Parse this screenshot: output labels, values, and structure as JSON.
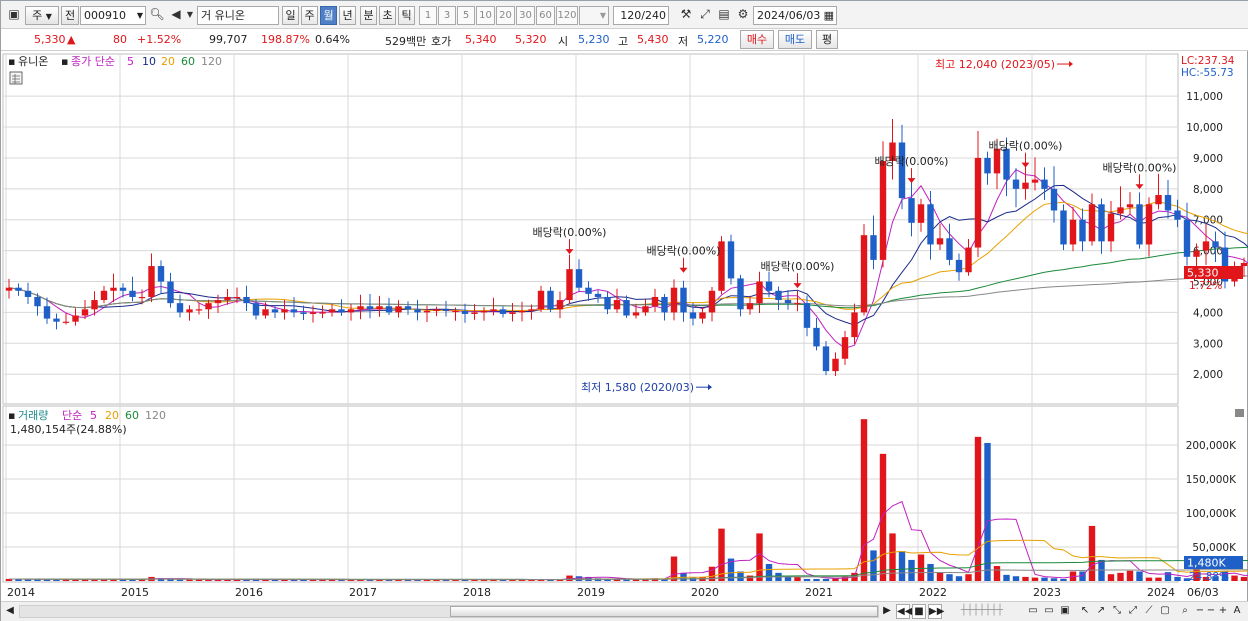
{
  "toolbar": {
    "market_type": "주",
    "prev_label": "전",
    "stock_code": "000910",
    "stock_name": "거 유니온",
    "periods": [
      {
        "label": "일",
        "active": false
      },
      {
        "label": "주",
        "active": false
      },
      {
        "label": "월",
        "active": true
      },
      {
        "label": "년",
        "active": false
      },
      {
        "label": "분",
        "active": false
      },
      {
        "label": "초",
        "active": false
      },
      {
        "label": "틱",
        "active": false
      }
    ],
    "interval_numbers": [
      "1",
      "3",
      "5",
      "10",
      "20",
      "30",
      "60",
      "120"
    ],
    "count_display": "120",
    "count_total": "/240",
    "date": "2024/06/03"
  },
  "quote": {
    "price": "5,330",
    "change_arrow": "▲",
    "change": "80",
    "change_pct": "+1.52%",
    "volume": "99,707",
    "volume_ratio": "198.87%",
    "turnover": "0.64%",
    "amount": "529백만",
    "bid_label": "호가",
    "ask_price": "5,340",
    "bid_price": "5,320",
    "open_label": "시",
    "open": "5,230",
    "high_label": "고",
    "high": "5,430",
    "low_label": "저",
    "low": "5,220",
    "buy_label": "매수",
    "sell_label": "매도",
    "eval_label": "평"
  },
  "price_panel": {
    "stock_label": "유니온",
    "legend_title": "종가 단순",
    "ma_labels": [
      {
        "label": "5",
        "color": "#c020c0"
      },
      {
        "label": "10",
        "color": "#1a2a8a"
      },
      {
        "label": "20",
        "color": "#e8a000"
      },
      {
        "label": "60",
        "color": "#1a8a3a"
      },
      {
        "label": "120",
        "color": "#888888"
      }
    ],
    "lc_label": "LC:237.34",
    "hc_label": "HC:-55.73",
    "current_price_tag": "5,330",
    "current_pct_tag": "1.72%",
    "high_annotation": "최고 12,040 (2023/05)",
    "low_annotation": "최저 1,580 (2020/03)",
    "dividend_label": "배당락(0.00%)"
  },
  "volume_panel": {
    "title": "거래량",
    "legend_title": "단순",
    "ma_labels": [
      {
        "label": "5",
        "color": "#c020c0"
      },
      {
        "label": "20",
        "color": "#e8a000"
      },
      {
        "label": "60",
        "color": "#1a8a3a"
      },
      {
        "label": "120",
        "color": "#888888"
      }
    ],
    "volume_info": "1,480,154주(24.88%)",
    "current_volume_tag": "1,480K",
    "current_pct_tag": "24.88%"
  },
  "x_axis_end_label": "06/03",
  "colors": {
    "up": "#e0161b",
    "down": "#1f5fc8",
    "grid": "#d8d8d8",
    "ma5": "#c020c0",
    "ma10": "#1a2a8a",
    "ma20": "#e8a000",
    "ma60": "#1a8a3a",
    "ma120": "#888888"
  },
  "chart_data": {
    "type": "candlestick",
    "period": "monthly",
    "price_ylim": [
      1100,
      12300
    ],
    "price_ticks": [
      2000,
      3000,
      4000,
      5000,
      6000,
      7000,
      8000,
      9000,
      10000,
      11000
    ],
    "volume_ylim": [
      0,
      250000
    ],
    "volume_ticks": [
      {
        "value": 50000,
        "label": "50,000K"
      },
      {
        "value": 100000,
        "label": "100,000K"
      },
      {
        "value": 150000,
        "label": "150,000K"
      },
      {
        "value": 200000,
        "label": "200,000K"
      }
    ],
    "year_labels": [
      "2014",
      "2015",
      "2016",
      "2017",
      "2018",
      "2019",
      "2020",
      "2021",
      "2022",
      "2023",
      "2024"
    ],
    "first_month": "2014-01",
    "close": [
      4800,
      4700,
      4500,
      4200,
      3800,
      3700,
      3700,
      3900,
      4100,
      4400,
      4700,
      4800,
      4700,
      4500,
      4500,
      5500,
      5000,
      4300,
      4000,
      4100,
      4100,
      4300,
      4400,
      4500,
      4500,
      4300,
      3900,
      4100,
      4000,
      4100,
      4000,
      3950,
      4000,
      4000,
      4100,
      4000,
      4100,
      4200,
      4100,
      4200,
      4000,
      4200,
      4100,
      4000,
      4050,
      4100,
      4050,
      4050,
      3950,
      4000,
      4050,
      4100,
      3950,
      4000,
      4050,
      4100,
      4700,
      4100,
      4400,
      5400,
      4800,
      4600,
      4500,
      4100,
      4400,
      3900,
      4000,
      4200,
      4500,
      4000,
      4800,
      4000,
      3800,
      4000,
      4700,
      6300,
      5100,
      4100,
      4300,
      5000,
      4700,
      4400,
      4300,
      4300,
      3500,
      2900,
      2100,
      2500,
      3200,
      4000,
      6500,
      5700,
      8900,
      9500,
      7700,
      6900,
      7500,
      6200,
      6400,
      5700,
      5300,
      6100,
      9000,
      8500,
      9300,
      8300,
      8000,
      8200,
      8300,
      8000,
      7300,
      6200,
      7000,
      6300,
      7500,
      6300,
      7200,
      7400,
      7500,
      6200,
      7500,
      7800,
      7300,
      7000,
      5800,
      6000,
      6300,
      6100,
      5000,
      5500,
      5600,
      5000,
      4900,
      5200,
      6100,
      5800,
      8900,
      9000,
      7000,
      6200,
      6100,
      5500,
      5900,
      5600,
      5000,
      5000,
      5000,
      5600,
      5400,
      5500,
      5600,
      5350,
      5400,
      5600,
      5250,
      5330
    ],
    "volume_k": [
      3000,
      3000,
      2500,
      2500,
      2500,
      2500,
      2500,
      2500,
      2500,
      2500,
      2500,
      2500,
      2500,
      2500,
      3000,
      6000,
      4000,
      2500,
      2000,
      2000,
      2000,
      2000,
      2000,
      2000,
      2000,
      2000,
      2000,
      2000,
      2000,
      2000,
      2000,
      2000,
      2000,
      2000,
      2000,
      2000,
      2000,
      2000,
      2000,
      2000,
      2000,
      2000,
      2000,
      2000,
      2000,
      2000,
      2000,
      2000,
      2000,
      2000,
      2000,
      2000,
      2000,
      2000,
      2000,
      2000,
      2000,
      2000,
      2000,
      8000,
      7000,
      6000,
      4000,
      3000,
      3000,
      2000,
      3000,
      3000,
      4000,
      3000,
      36000,
      12000,
      5000,
      6000,
      21000,
      77000,
      33000,
      14000,
      8000,
      70000,
      25000,
      12000,
      8000,
      6000,
      3000,
      3000,
      3000,
      4000,
      8000,
      12000,
      238000,
      45000,
      187000,
      70000,
      44000,
      31000,
      39000,
      25000,
      12000,
      10000,
      7000,
      10000,
      212000,
      203000,
      22000,
      9000,
      7000,
      6000,
      5000,
      5000,
      4000,
      3000,
      14000,
      14000,
      81000,
      31000,
      10000,
      12000,
      15000,
      14000,
      5000,
      5000,
      13000,
      6000,
      4000,
      23000,
      6000,
      7000,
      14000,
      8000,
      6000,
      6000,
      4000,
      4000,
      30000,
      14000,
      200000,
      86000,
      14000,
      14000,
      15000,
      16000,
      14000,
      16000,
      15000,
      23000,
      45000,
      13000,
      12000,
      6000,
      5000,
      4000,
      5000,
      4000,
      9000,
      3000
    ],
    "max": {
      "value": 12040,
      "date": "2023/05"
    },
    "min": {
      "value": 1580,
      "date": "2020/03"
    },
    "dividend_events": [
      {
        "date": "2018-12",
        "label": "배당락(0.00%)"
      },
      {
        "date": "2019-12",
        "label": "배당락(0.00%)"
      },
      {
        "date": "2020-12",
        "label": "배당락(0.00%)"
      },
      {
        "date": "2021-12",
        "label": "배당락(0.00%)"
      },
      {
        "date": "2022-12",
        "label": "배당락(0.00%)"
      },
      {
        "date": "2023-12",
        "label": "배당락(0.00%)"
      }
    ],
    "moving_averages": [
      5,
      10,
      20,
      60,
      120
    ]
  }
}
